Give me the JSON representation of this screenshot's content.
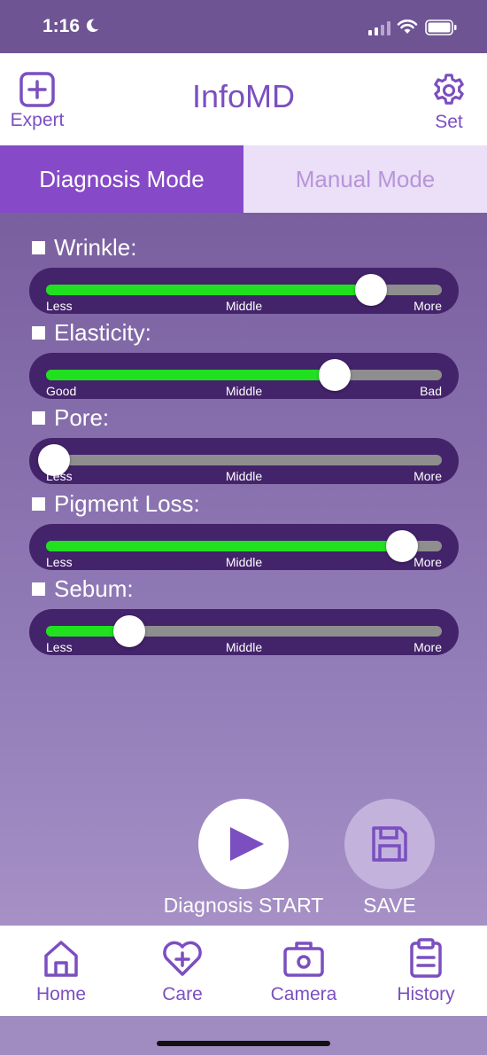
{
  "status_bar": {
    "time": "1:16"
  },
  "header": {
    "title": "InfoMD",
    "left_label": "Expert",
    "right_label": "Set"
  },
  "tabs": [
    {
      "label": "Diagnosis Mode",
      "active": true
    },
    {
      "label": "Manual Mode",
      "active": false
    }
  ],
  "params": [
    {
      "label": "Wrinkle:",
      "low": "Less",
      "mid": "Middle",
      "high": "More",
      "level": 0.82
    },
    {
      "label": "Elasticity:",
      "low": "Good",
      "mid": "Middle",
      "high": "Bad",
      "level": 0.73
    },
    {
      "label": "Pore:",
      "low": "Less",
      "mid": "Middle",
      "high": "More",
      "level": 0.02
    },
    {
      "label": "Pigment Loss:",
      "low": "Less",
      "mid": "Middle",
      "high": "More",
      "level": 0.9
    },
    {
      "label": "Sebum:",
      "low": "Less",
      "mid": "Middle",
      "high": "More",
      "level": 0.21
    }
  ],
  "actions": {
    "start_label": "Diagnosis START",
    "save_label": "SAVE"
  },
  "nav": [
    {
      "label": "Home",
      "icon": "home-icon"
    },
    {
      "label": "Care",
      "icon": "heart-plus-icon"
    },
    {
      "label": "Camera",
      "icon": "camera-icon"
    },
    {
      "label": "History",
      "icon": "clipboard-icon"
    }
  ],
  "colors": {
    "accent": "#7b4fc0",
    "active_tab": "#8649c8",
    "slider_fill": "#20e020"
  }
}
